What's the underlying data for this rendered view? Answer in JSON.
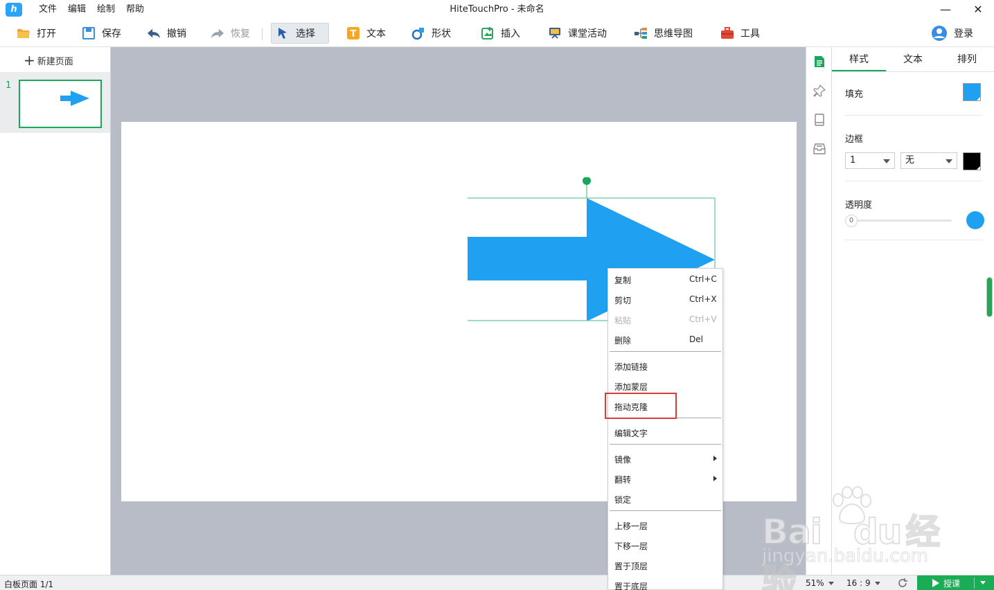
{
  "window": {
    "title": "HiteTouchPro - 未命名",
    "logo_letter": "h",
    "menu": [
      "文件",
      "编辑",
      "绘制",
      "帮助"
    ],
    "minimize_glyph": "—",
    "close_glyph": "✕"
  },
  "toolbar": {
    "open": "打开",
    "save": "保存",
    "undo": "撤销",
    "redo": "恢复",
    "select": "选择",
    "text": "文本",
    "shape": "形状",
    "insert": "插入",
    "classroom": "课堂活动",
    "mindmap": "思维导图",
    "tools": "工具",
    "login": "登录"
  },
  "pages": {
    "new_page": "新建页面",
    "plus_glyph": "+",
    "items": [
      {
        "number": "1"
      }
    ]
  },
  "properties": {
    "tabs": [
      "样式",
      "文本",
      "排列"
    ],
    "active_tab": "样式",
    "fill_label": "填充",
    "fill_color": "#20a0f0",
    "border_label": "边框",
    "border_width": "1",
    "border_style": "无",
    "border_color": "#000000",
    "opacity_label": "透明度",
    "opacity_value": "0",
    "opacity_color": "#20a0f0"
  },
  "context_menu": {
    "items": [
      {
        "label": "复制",
        "shortcut": "Ctrl+C"
      },
      {
        "label": "剪切",
        "shortcut": "Ctrl+X"
      },
      {
        "label": "粘贴",
        "shortcut": "Ctrl+V",
        "disabled": true
      },
      {
        "label": "删除",
        "shortcut": "Del"
      },
      {
        "label": "添加链接"
      },
      {
        "label": "添加蒙层"
      },
      {
        "label": "拖动克隆",
        "highlighted": true
      },
      {
        "label": "编辑文字"
      },
      {
        "label": "镜像",
        "submenu": true
      },
      {
        "label": "翻转",
        "submenu": true
      },
      {
        "label": "锁定"
      },
      {
        "label": "上移一层"
      },
      {
        "label": "下移一层"
      },
      {
        "label": "置于顶层"
      },
      {
        "label": "置于底层"
      }
    ]
  },
  "statusbar": {
    "page_info": "白板页面 1/1",
    "zoom": "51%",
    "ratio": "16 : 9",
    "present": "授课"
  },
  "watermark": {
    "brand": "Bai",
    "brand_tail": "du",
    "cn": "经验",
    "url": "jingyan.baidu.com"
  },
  "colors": {
    "accent": "#1aa55c",
    "shape_fill": "#20a0f0",
    "highlight": "#d93a3a"
  }
}
